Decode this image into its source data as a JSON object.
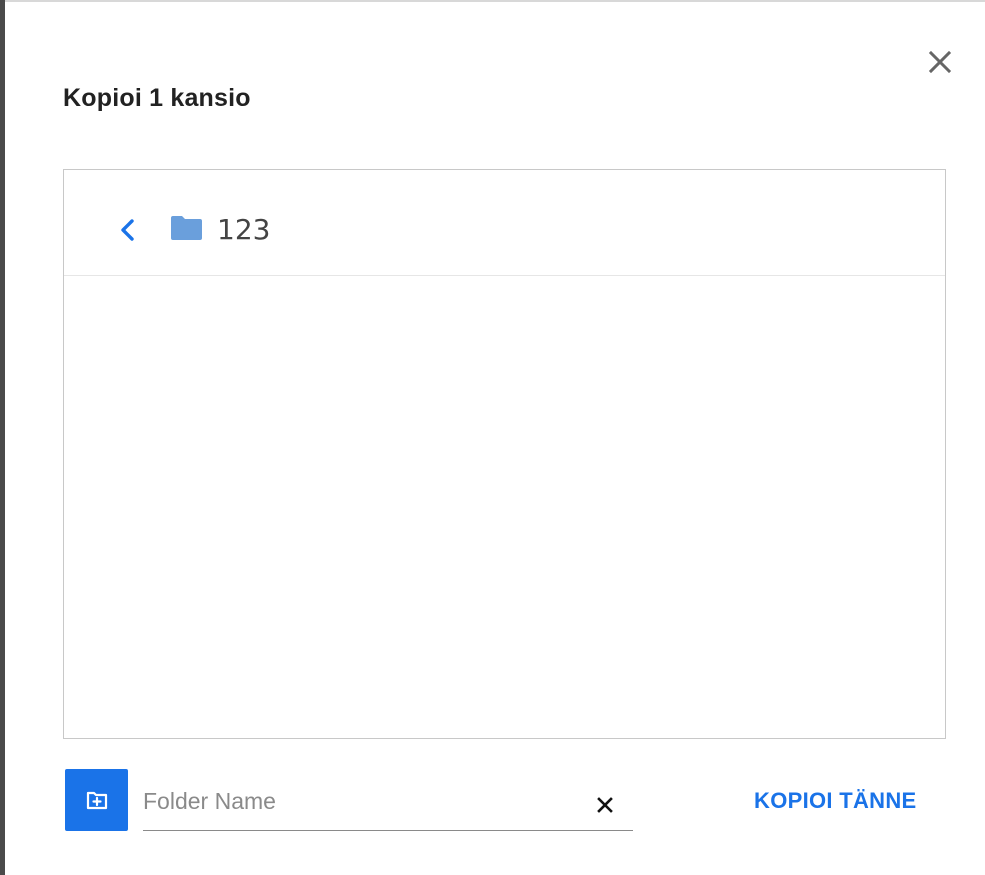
{
  "dialog": {
    "title": "Kopioi 1 kansio",
    "close_icon": "close-icon"
  },
  "browser": {
    "back_icon": "chevron-left-icon",
    "folder_icon": "folder-icon",
    "current_folder": "123",
    "items": []
  },
  "footer": {
    "new_folder_icon": "new-folder-icon",
    "folder_name_placeholder": "Folder Name",
    "folder_name_value": "",
    "clear_icon": "clear-icon",
    "copy_here_label": "KOPIOI TÄNNE"
  },
  "colors": {
    "accent": "#1a73e8",
    "folder": "#6a9fdc",
    "border": "#c8c8c8",
    "title_text": "#222222",
    "placeholder_text": "#8a8a8a"
  }
}
